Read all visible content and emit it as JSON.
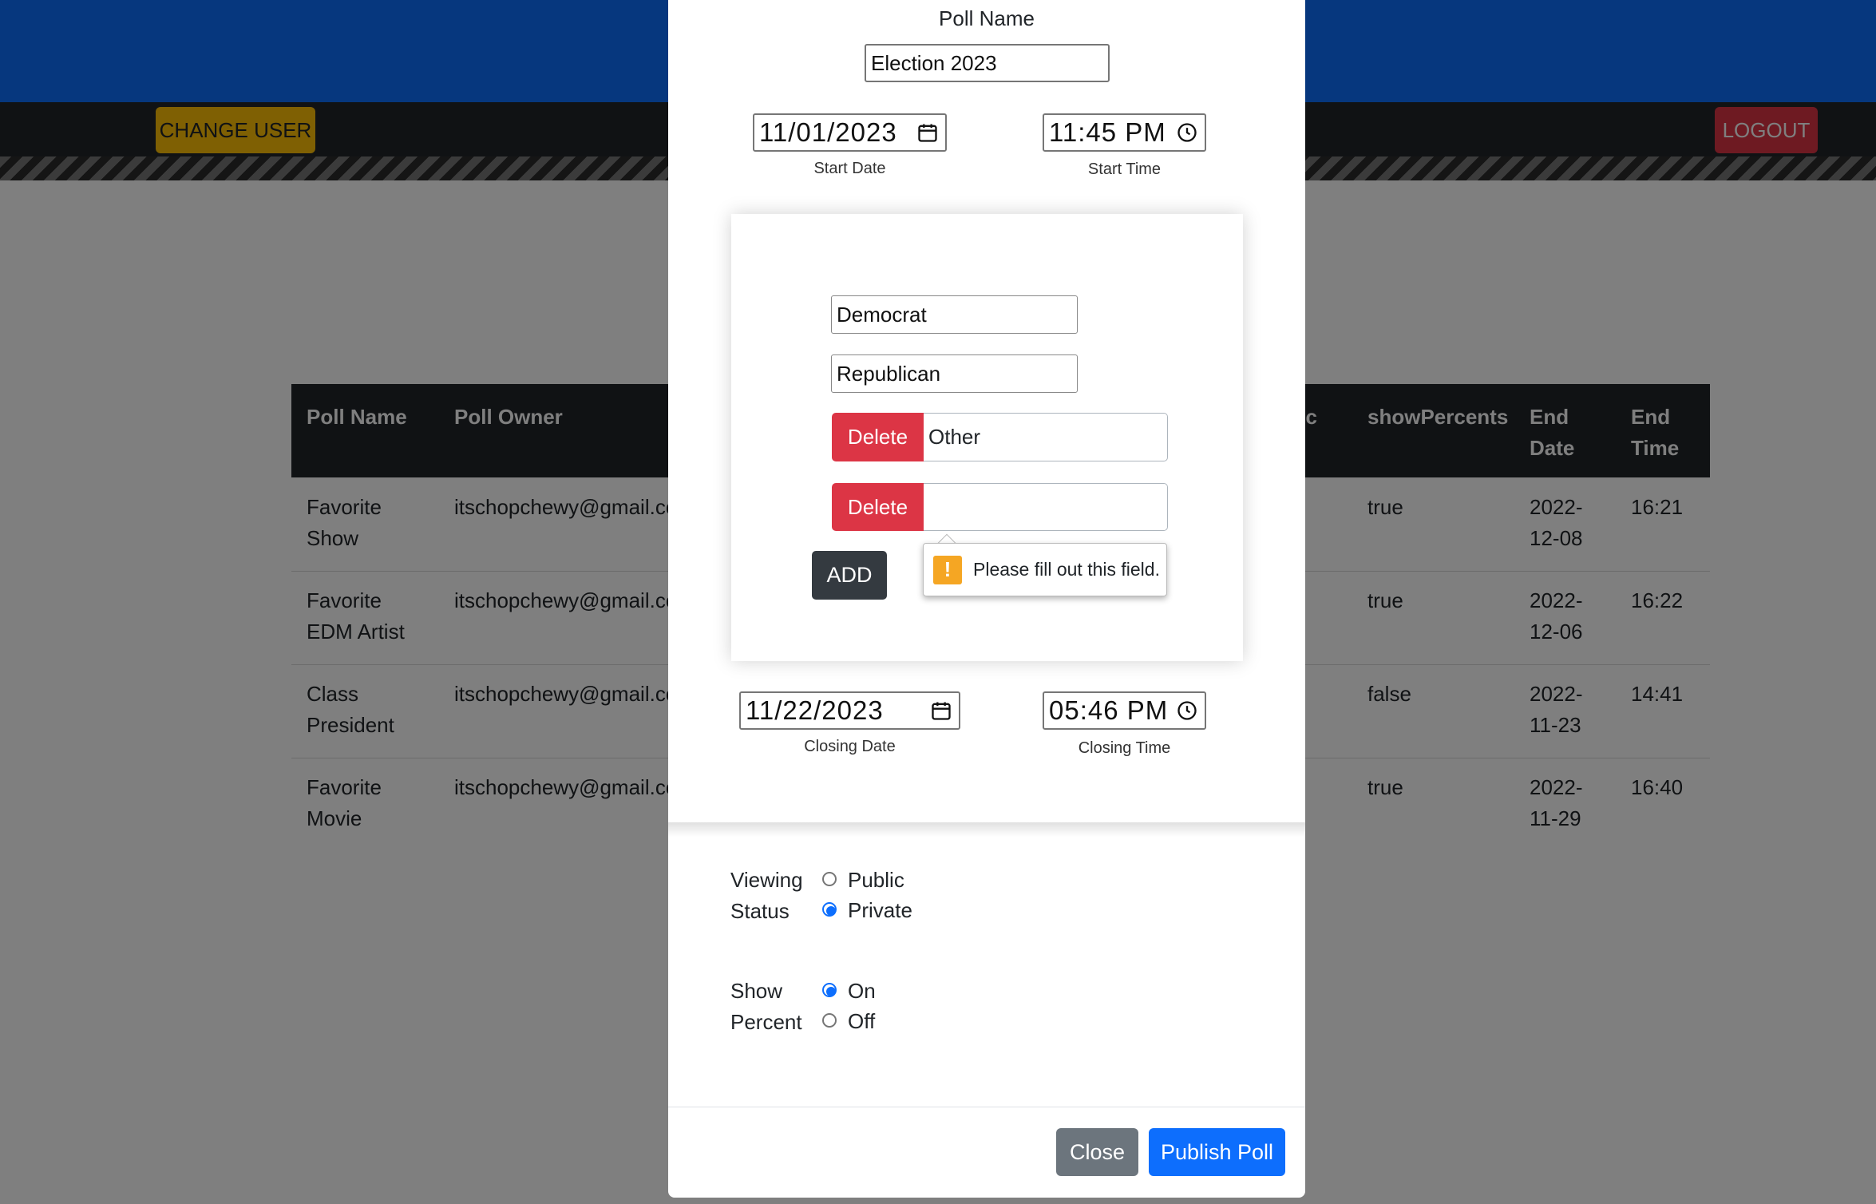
{
  "nav": {
    "change_user_label": "CHANGE USER",
    "logout_label": "LOGOUT"
  },
  "table": {
    "headers": [
      "Poll Name",
      "Poll Owner",
      "lic",
      "showPercents",
      "End Date",
      "End Time"
    ],
    "rows": [
      {
        "name": "Favorite Show",
        "owner": "itschopchewy@gmail.co",
        "show_percents": "true",
        "end_date": "2022-12-08",
        "end_time": "16:21"
      },
      {
        "name": "Favorite EDM Artist",
        "owner": "itschopchewy@gmail.co",
        "show_percents": "true",
        "end_date": "2022-12-06",
        "end_time": "16:22"
      },
      {
        "name": "Class President",
        "owner": "itschopchewy@gmail.co",
        "show_percents": "false",
        "end_date": "2022-11-23",
        "end_time": "14:41"
      },
      {
        "name": "Favorite Movie",
        "owner": "itschopchewy@gmail.co",
        "show_percents": "true",
        "end_date": "2022-11-29",
        "end_time": "16:40"
      }
    ]
  },
  "modal": {
    "poll_name_label": "Poll Name",
    "poll_name_value": "Election 2023",
    "start_date_value": "11/01/2023",
    "start_date_label": "Start Date",
    "start_time_value": "11:45 PM",
    "start_time_label": "Start Time",
    "options": [
      {
        "value": "Democrat",
        "deletable": false
      },
      {
        "value": "Republican",
        "deletable": false
      },
      {
        "value": "Other",
        "deletable": true
      },
      {
        "value": "",
        "deletable": true
      }
    ],
    "delete_label": "Delete",
    "add_label": "ADD",
    "validation_message": "Please fill out this field.",
    "closing_date_value": "11/22/2023",
    "closing_date_label": "Closing Date",
    "closing_time_value": "05:46 PM",
    "closing_time_label": "Closing Time",
    "viewing_status": {
      "label_line1": "Viewing",
      "label_line2": "Status",
      "options": [
        "Public",
        "Private"
      ],
      "selected": "Private"
    },
    "show_percent": {
      "label_line1": "Show",
      "label_line2": "Percent",
      "options": [
        "On",
        "Off"
      ],
      "selected": "On"
    },
    "close_label": "Close",
    "publish_label": "Publish Poll"
  },
  "colors": {
    "primary": "#0d6efd",
    "danger": "#dc3545",
    "warning": "#ffc107",
    "dark": "#212529",
    "secondary": "#6c757d"
  }
}
